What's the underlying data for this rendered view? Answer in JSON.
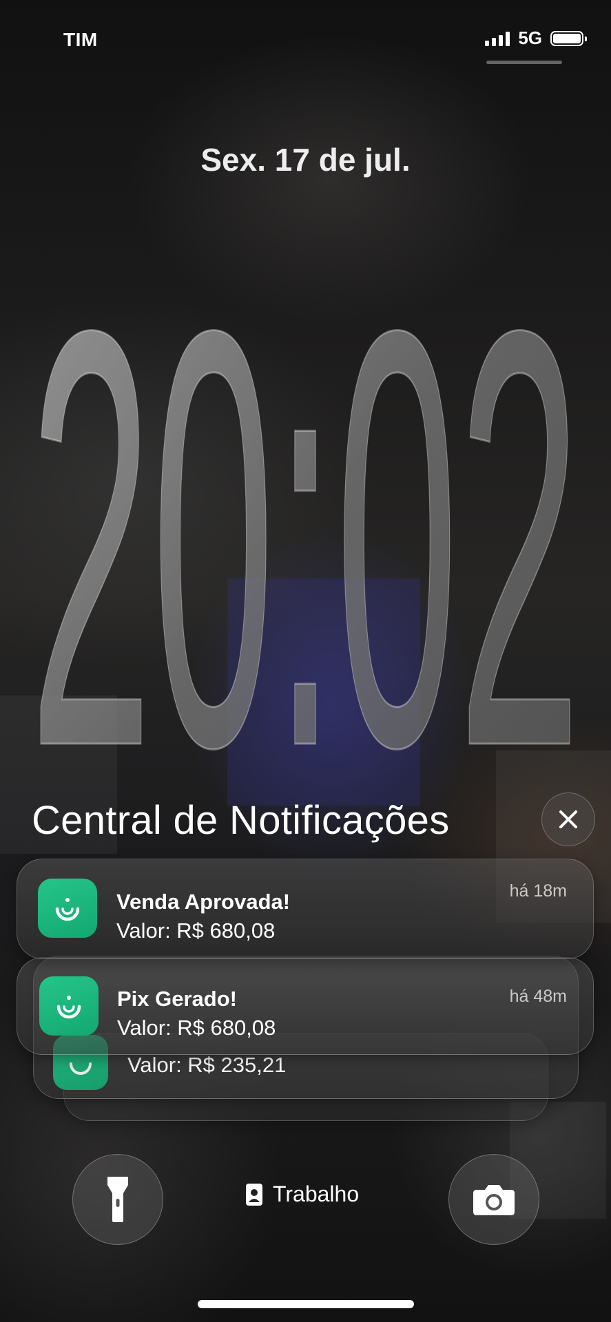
{
  "status_bar": {
    "carrier": "TIM",
    "network": "5G",
    "battery_level": 1.0
  },
  "lock_screen": {
    "date": "Sex. 17 de jul.",
    "time": "20:02"
  },
  "notification_center": {
    "title": "Central de Notificações",
    "close_icon": "close-icon"
  },
  "notifications": [
    {
      "app_icon": "app-logo-icon",
      "title": "Venda Aprovada!",
      "body": "Valor: R$ 680,08",
      "time": "há 18m"
    },
    {
      "app_icon": "app-logo-icon",
      "title": "Pix Gerado!",
      "body": "Valor: R$ 680,08",
      "time": "há 48m"
    },
    {
      "app_icon": "app-logo-icon",
      "title": "",
      "body": "Valor: R$ 235,21",
      "time": ""
    }
  ],
  "bottom_bar": {
    "flashlight_icon": "flashlight-icon",
    "focus_icon": "badge-icon",
    "focus_label": "Trabalho",
    "camera_icon": "camera-icon"
  },
  "colors": {
    "app_icon": "#1db87e",
    "clock_fill": "#8a8a8a"
  }
}
